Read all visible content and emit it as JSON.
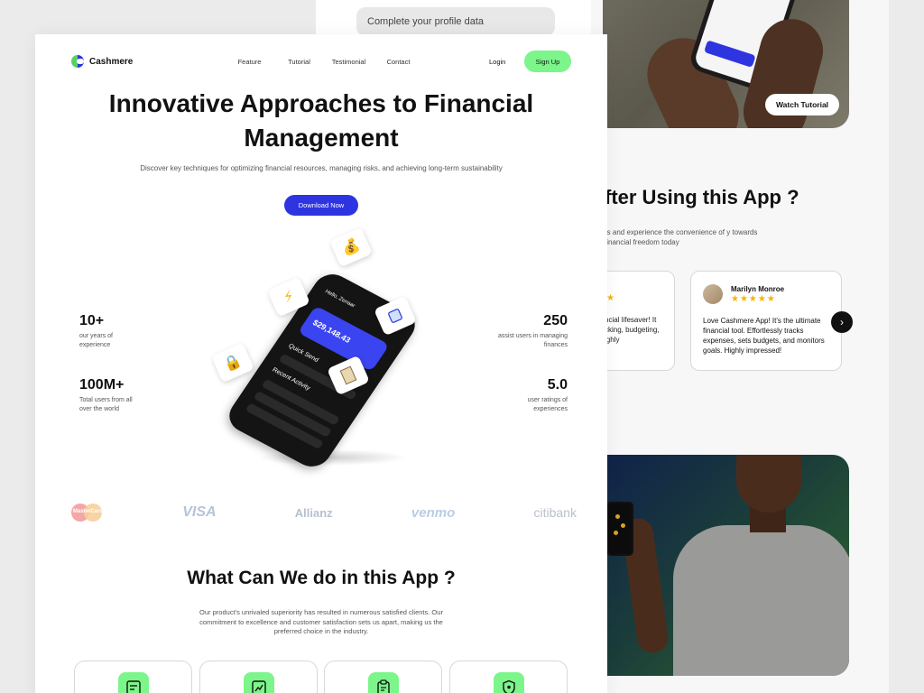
{
  "background_page": {
    "profile_pill": "Complete your  profile data",
    "watch_tutorial": "Watch Tutorial",
    "after_title": "fter Using this App ?",
    "after_sub": "rs and experience the convenience of y towards financial freedom today",
    "review_partial": {
      "text": "ncial lifesaver! It cking, budgeting, ighly"
    },
    "review_main": {
      "name": "Marilyn Monroe",
      "stars": "★★★★★",
      "text": "Love Cashmere App! It's the ultimate financial tool. Effortlessly tracks expenses, sets budgets, and monitors goals. Highly impressed!"
    },
    "next_arrow": "›",
    "partial_stars": "★"
  },
  "brand": {
    "name": "Cashmere"
  },
  "nav": {
    "links": [
      "Feature",
      "Tutorial",
      "Testimonial",
      "Contact"
    ],
    "login": "Login",
    "signup": "Sign Up"
  },
  "hero": {
    "title": "Innovative Approaches to Financial Management",
    "subtitle": "Discover key techniques for optimizing financial resources, managing risks, and achieving long-term sustainability",
    "cta": "Download Now"
  },
  "phone": {
    "balance": "$29,148.43",
    "greeting": "Hello, Zenaar",
    "section1": "Quick Send",
    "section2": "Recent Activity"
  },
  "float_icons": [
    "money-bag-icon",
    "lightning-icon",
    "padlock-icon",
    "card-icon",
    "document-icon"
  ],
  "stats": {
    "left": [
      {
        "value": "10+",
        "label": "our years of experience"
      },
      {
        "value": "100M+",
        "label": "Total users from all over the world"
      }
    ],
    "right": [
      {
        "value": "250",
        "label": "assist users in managing finances"
      },
      {
        "value": "5.0",
        "label": "user ratings of experiences"
      }
    ]
  },
  "partners": [
    "MasterCard",
    "VISA",
    "Allianz",
    "venmo",
    "citibank"
  ],
  "features": {
    "title": "What Can We do in this App ?",
    "subtitle": "Our product's unrivaled superiority has resulted in numerous satisfied clients. Our commitment to excellence and customer satisfaction sets us apart, making us the preferred choice in the industry.",
    "cards": [
      "report-icon",
      "growth-chart-icon",
      "clipboard-icon",
      "shield-icon"
    ]
  },
  "colors": {
    "primary": "#2e35e0",
    "accent": "#7cf58a",
    "text": "#111111"
  }
}
